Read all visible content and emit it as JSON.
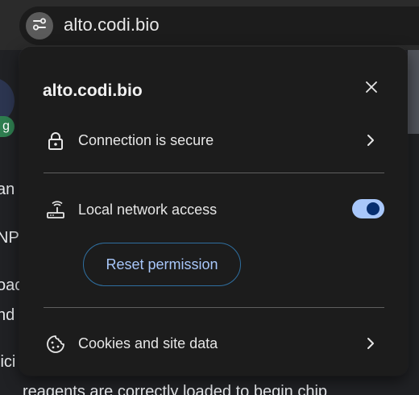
{
  "address_bar": {
    "url": "alto.codi.bio",
    "site_info_icon": "tune-icon"
  },
  "background_page": {
    "badge_text": "g",
    "lines": [
      "an",
      "NP",
      "oac",
      "nd",
      "lici",
      "reagents are correctly loaded to begin chip"
    ]
  },
  "site_info_popup": {
    "title": "alto.codi.bio",
    "close_icon": "close-icon",
    "connection": {
      "label": "Connection is secure",
      "icon": "lock-icon"
    },
    "local_network": {
      "label": "Local network access",
      "icon": "router-icon",
      "toggle_on": true
    },
    "reset_label": "Reset permission",
    "cookies": {
      "label": "Cookies and site data",
      "icon": "cookie-icon"
    }
  },
  "colors": {
    "accent": "#a8c7fa",
    "toggle_knob": "#062e6f",
    "popup_bg": "#1c1c1c"
  }
}
